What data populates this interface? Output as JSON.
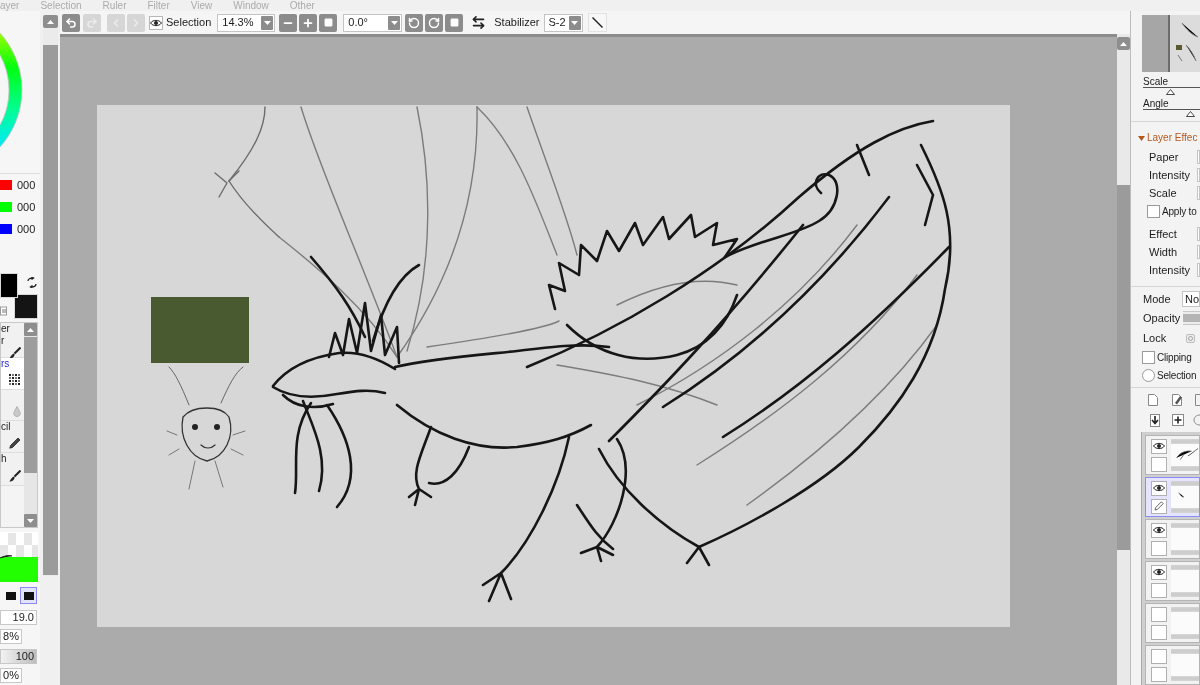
{
  "menu_bar": [
    "ayer",
    "Selection",
    "Ruler",
    "Filter",
    "View",
    "Window",
    "Other"
  ],
  "toolbar": {
    "history": [
      {
        "kind": "undo",
        "disabled": false
      },
      {
        "kind": "redo",
        "disabled": true
      },
      {
        "kind": "back",
        "disabled": true
      },
      {
        "kind": "forward",
        "disabled": true
      }
    ],
    "selection_toggle": {
      "label": "Selection"
    },
    "zoom": {
      "value": "14.3%"
    },
    "rotation": {
      "value": "0.0°"
    },
    "stabilizer": {
      "label": "Stabilizer",
      "value": "S-2"
    }
  },
  "color_panel": {
    "rgb_sliders": [
      {
        "color": "#ff0000",
        "value": "000"
      },
      {
        "color": "#00ff00",
        "value": "000"
      },
      {
        "color": "#0000ff",
        "value": "000"
      }
    ],
    "swatches": [
      {
        "kind": "primary",
        "color": "#000000"
      },
      {
        "kind": "secondary",
        "color": "#141414"
      }
    ]
  },
  "tools": [
    {
      "kind": "brush",
      "label_lines": [
        "er",
        "r"
      ],
      "selected": false
    },
    {
      "kind": "dots",
      "label_lines": [
        "rs"
      ],
      "selected": true
    },
    {
      "kind": "droplet",
      "selected": false
    },
    {
      "kind": "pencil",
      "label_lines": [
        "cil"
      ],
      "selected": false
    },
    {
      "kind": "brush",
      "label_lines": [
        "h"
      ],
      "selected": false
    }
  ],
  "brush_shapes": [
    {
      "selected": false
    },
    {
      "selected": true
    }
  ],
  "brush_settings": [
    {
      "kind": "wide",
      "value": "19.0"
    },
    {
      "kind": "short",
      "value": "8%"
    },
    {
      "kind": "slider",
      "value": "100",
      "level": 1
    },
    {
      "kind": "short",
      "value": "0%"
    }
  ],
  "navigator": {
    "sliders": [
      {
        "label": "Scale",
        "level": 0.48
      },
      {
        "label": "Angle",
        "level": 0.83
      }
    ]
  },
  "layer_effects": {
    "title": "Layer Effec",
    "expanded": true,
    "rows": [
      {
        "kind": "field",
        "label": "Paper"
      },
      {
        "kind": "field",
        "label": "Intensity"
      },
      {
        "kind": "field",
        "label": "Scale"
      },
      {
        "kind": "checkbox",
        "label": "Apply to",
        "checked": false
      },
      {
        "kind": "field",
        "label": "Effect"
      },
      {
        "kind": "field",
        "label": "Width"
      },
      {
        "kind": "field",
        "label": "Intensity"
      }
    ]
  },
  "layer_properties": {
    "mode": {
      "label": "Mode",
      "value": "No"
    },
    "opacity": {
      "label": "Opacity",
      "level": 1
    },
    "lock": {
      "label": "Lock"
    },
    "clipping": {
      "label": "Clipping",
      "checked": false
    },
    "selection_source": {
      "label": "Selection",
      "selected": false
    }
  },
  "layers": [
    {
      "visible": true,
      "selected": false
    },
    {
      "visible": true,
      "selected": true
    },
    {
      "visible": true,
      "selected": false
    },
    {
      "visible": true,
      "selected": false
    },
    {
      "visible": false,
      "selected": false
    },
    {
      "visible": false,
      "selected": false
    }
  ]
}
